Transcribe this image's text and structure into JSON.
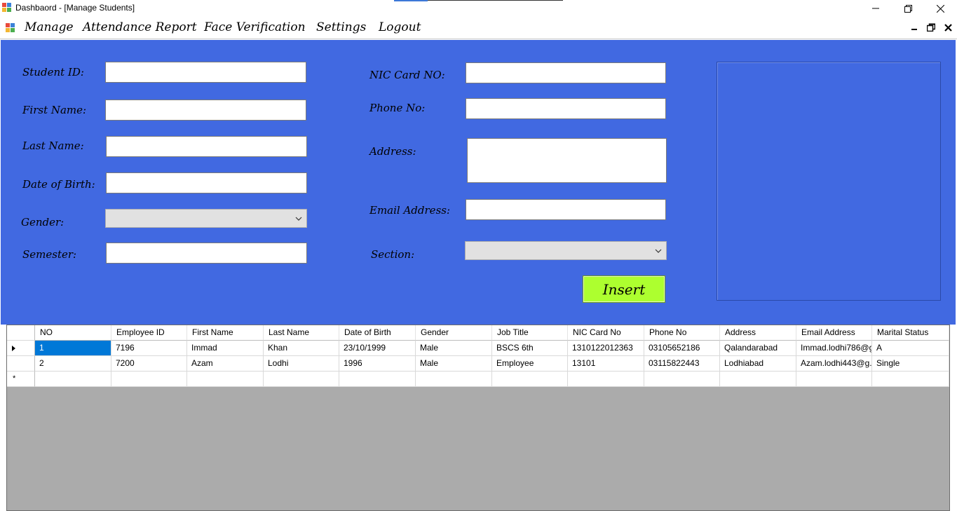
{
  "window": {
    "title": "Dashbaord - [Manage Students]"
  },
  "menu": {
    "items": [
      "Manage",
      "Attendance Report",
      "Face Verification",
      "Settings",
      "Logout"
    ]
  },
  "form": {
    "student_id_label": "Student ID:",
    "first_name_label": "First Name:",
    "last_name_label": "Last Name:",
    "dob_label": "Date of Birth:",
    "gender_label": "Gender:",
    "semester_label": "Semester:",
    "nic_label": "NIC Card NO:",
    "phone_label": "Phone No:",
    "address_label": "Address:",
    "email_label": "Email Address:",
    "section_label": "Section:",
    "student_id_value": "",
    "first_name_value": "",
    "last_name_value": "",
    "dob_value": "",
    "gender_value": "",
    "semester_value": "",
    "nic_value": "",
    "phone_value": "",
    "address_value": "",
    "email_value": "",
    "section_value": "",
    "insert_label": "Insert"
  },
  "grid": {
    "columns": [
      "NO",
      "Employee ID",
      "First Name",
      "Last Name",
      "Date of Birth",
      "Gender",
      "Job Title",
      "NIC Card No",
      "Phone No",
      "Address",
      "Email Address",
      "Marital Status"
    ],
    "rows": [
      [
        "1",
        "7196",
        "Immad",
        "Khan",
        "23/10/1999",
        "Male",
        "BSCS 6th",
        "1310122012363",
        "03105652186",
        "Qalandarabad",
        "Immad.lodhi786@g...",
        "A"
      ],
      [
        "2",
        "7200",
        "Azam",
        "Lodhi",
        "1996",
        "Male",
        "Employee",
        "13101",
        "03115822443",
        "Lodhiabad",
        "Azam.lodhi443@g...",
        "Single"
      ]
    ],
    "current_row_marker": "▶",
    "new_row_marker": "*"
  },
  "colors": {
    "form_background": "#4169e1",
    "insert_button": "#adff2f",
    "grid_background": "#ababab",
    "selection": "#0078d7"
  },
  "icons": {
    "app": "app-icon",
    "minimize": "minimize-icon",
    "restore": "restore-icon",
    "close": "close-icon",
    "dropdown": "chevron-down-icon"
  }
}
